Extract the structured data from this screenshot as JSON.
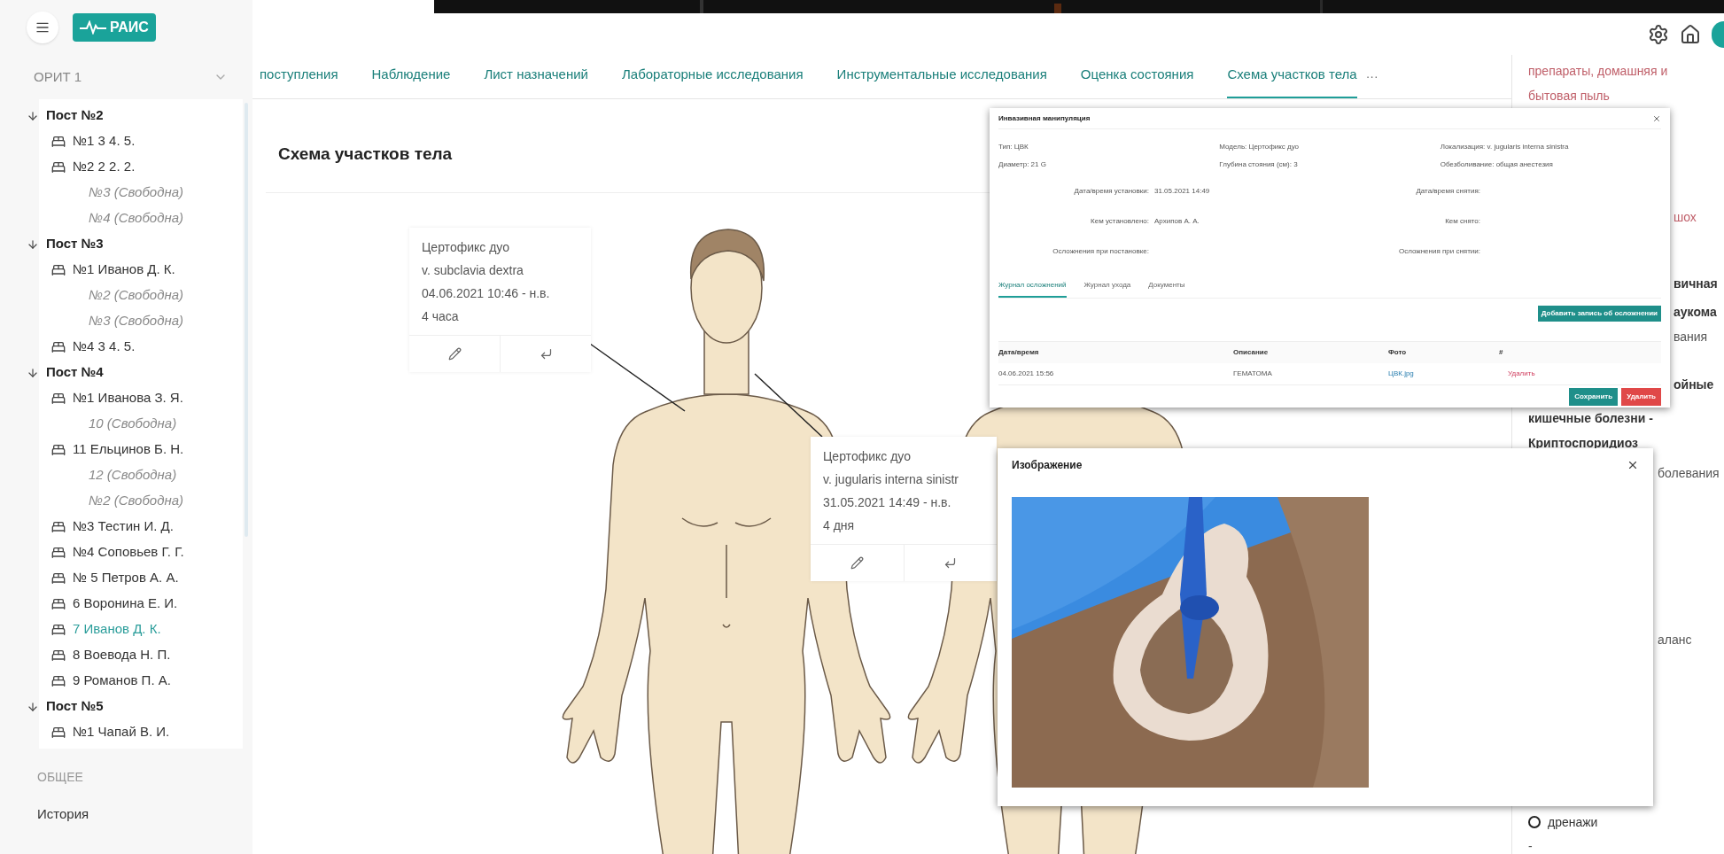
{
  "header": {
    "logo_text": "РАИС"
  },
  "sidebar": {
    "department": "ОРИТ 1",
    "posts": [
      {
        "label": "Пост №2",
        "expanded": true,
        "children": [
          {
            "label": "№1 3 4. 5.",
            "kind": "bed",
            "selected": false
          },
          {
            "label": "№2 2 2. 2.",
            "kind": "bed",
            "selected": false
          },
          {
            "label": "№3 (Свободна)",
            "kind": "free",
            "selected": false
          },
          {
            "label": "№4 (Свободна)",
            "kind": "free",
            "selected": false
          }
        ]
      },
      {
        "label": "Пост №3",
        "expanded": true,
        "children": [
          {
            "label": "№1 Иванов Д. К.",
            "kind": "bed",
            "selected": false
          },
          {
            "label": "№2 (Свободна)",
            "kind": "free",
            "selected": false
          },
          {
            "label": "№3 (Свободна)",
            "kind": "free",
            "selected": false
          },
          {
            "label": "№4 3 4. 5.",
            "kind": "bed",
            "selected": false
          }
        ]
      },
      {
        "label": "Пост №4",
        "expanded": true,
        "children": [
          {
            "label": "№1 Иванова З. Я.",
            "kind": "bed",
            "selected": false
          },
          {
            "label": "10 (Свободна)",
            "kind": "free",
            "selected": false
          },
          {
            "label": "11 Ельцинов Б. Н.",
            "kind": "bed",
            "selected": false
          },
          {
            "label": "12 (Свободна)",
            "kind": "free",
            "selected": false
          },
          {
            "label": "№2 (Свободна)",
            "kind": "free",
            "selected": false
          },
          {
            "label": "№3 Тестин И. Д.",
            "kind": "bed",
            "selected": false
          },
          {
            "label": "№4 Соповьев Г. Г.",
            "kind": "bed",
            "selected": false
          },
          {
            "label": "№ 5 Петров А. А.",
            "kind": "bed",
            "selected": false
          },
          {
            "label": "6 Воронина Е. И.",
            "kind": "bed",
            "selected": false
          },
          {
            "label": "7 Иванов Д. К.",
            "kind": "bed",
            "selected": true
          },
          {
            "label": "8 Воевода Н. П.",
            "kind": "bed",
            "selected": false
          },
          {
            "label": "9 Романов П. А.",
            "kind": "bed",
            "selected": false
          }
        ]
      },
      {
        "label": "Пост №5",
        "expanded": true,
        "children": [
          {
            "label": "№1 Чапай В. И.",
            "kind": "bed",
            "selected": false
          }
        ]
      }
    ],
    "section_title": "ОБЩЕЕ",
    "links": [
      "История"
    ]
  },
  "tabs": [
    {
      "label": "поступления",
      "selected": false
    },
    {
      "label": "Наблюдение",
      "selected": false
    },
    {
      "label": "Лист назначений",
      "selected": false
    },
    {
      "label": "Лабораторные исследования",
      "selected": false
    },
    {
      "label": "Инструментальные исследования",
      "selected": false
    },
    {
      "label": "Оценка состояния",
      "selected": false
    },
    {
      "label": "Схема участков тела",
      "selected": true
    }
  ],
  "more_tabs": "···",
  "page_title": "Схема участков тела",
  "callouts": [
    {
      "lines": [
        "Цертофикс дуо",
        "v. subclavia dextra",
        "04.06.2021 10:46 - н.в.",
        "4 часа"
      ]
    },
    {
      "lines": [
        "Цертофикс дуо",
        "v. jugularis interna sinistr",
        "31.05.2021 14:49 - н.в.",
        "4 дня"
      ]
    }
  ],
  "manipulation_dialog": {
    "title": "Инвазивная манипуляция",
    "fields_top": [
      {
        "label": "Тип:",
        "value": "ЦВК"
      },
      {
        "label": "Модель:",
        "value": "Цертофикс дуо"
      },
      {
        "label": "Локализация:",
        "value": "v. jugularis interna sinistra"
      },
      {
        "label": "Диаметр:",
        "value": "21 G"
      },
      {
        "label": "Глубина стояния (см):",
        "value": "3"
      },
      {
        "label": "Обезболивание:",
        "value": "общая анестезия"
      }
    ],
    "fields_left": [
      {
        "label": "Дата/время установки:",
        "value": "31.05.2021 14:49"
      },
      {
        "label": "Кем установлено:",
        "value": "Архипов А. А."
      },
      {
        "label": "Осложнения при постановке:"
      }
    ],
    "fields_right": [
      {
        "label": "Дата/время снятия:"
      },
      {
        "label": "Кем снято:"
      },
      {
        "label": "Осложнения при снятии:"
      }
    ],
    "tabs": [
      {
        "label": "Журнал осложнений",
        "selected": true
      },
      {
        "label": "Журнал ухода",
        "selected": false
      },
      {
        "label": "Документы",
        "selected": false
      }
    ],
    "add_button": "Добавить запись об осложнении",
    "columns": [
      "Дата/время",
      "Описание",
      "Фото",
      "#"
    ],
    "rows": [
      {
        "datetime": "04.06.2021 15:56",
        "description": "ГЕМАТОМА",
        "photo": "ЦВК.jpg",
        "action": "Удалить"
      }
    ],
    "save_button": "Сохранить",
    "delete_button": "Удалить"
  },
  "image_dialog": {
    "title": "Изображение"
  },
  "right_panel": {
    "items": [
      {
        "kind": "link",
        "text": "препараты, домашняя и"
      },
      {
        "kind": "link",
        "text": "бытовая пыль"
      },
      {
        "kind": "link",
        "text": "шох"
      },
      {
        "kind": "bold",
        "text": "вичная"
      },
      {
        "kind": "bold",
        "text": "аукома"
      },
      {
        "kind": "text",
        "text": "вания"
      },
      {
        "kind": "bold",
        "text": "ойные"
      },
      {
        "kind": "bold",
        "text": "кишечные болезни -"
      },
      {
        "kind": "bold",
        "text": "Криптоспоридиоз"
      },
      {
        "kind": "text",
        "text": "болевания"
      },
      {
        "kind": "text",
        "text": "аланс"
      },
      {
        "kind": "radio",
        "text": "дренажи",
        "checked": false
      },
      {
        "kind": "text",
        "text": "-"
      }
    ]
  }
}
